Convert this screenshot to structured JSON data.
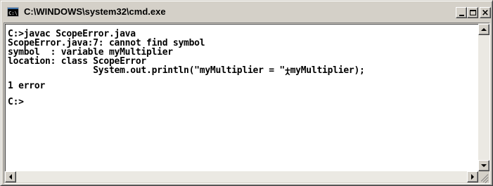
{
  "window": {
    "title": "C:\\WINDOWS\\system32\\cmd.exe",
    "icon": "console-icon",
    "icon_text": "C:\\"
  },
  "console": {
    "lines": [
      "C:>javac ScopeError.java",
      "ScopeError.java:7: cannot find symbol",
      "symbol  : variable myMultiplier",
      "location: class ScopeError",
      "                System.out.println(\"myMultiplier = \"+myMultiplier);",
      "                                                    ^",
      "1 error",
      "",
      "C:>"
    ]
  },
  "controls": {
    "minimize": "minimize-icon",
    "maximize": "maximize-icon",
    "close": "×"
  },
  "colors": {
    "chrome": "#d4d0c8",
    "console_bg": "#ffffff",
    "console_text": "#000000"
  }
}
